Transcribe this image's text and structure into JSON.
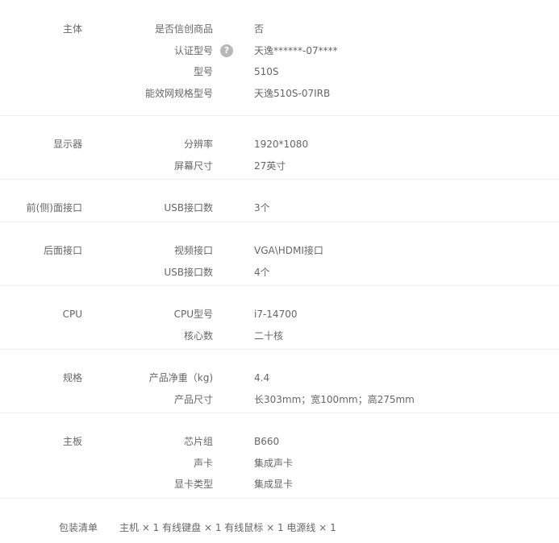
{
  "groups": [
    {
      "title": "主体",
      "rows": [
        {
          "label": "是否信创商品",
          "value": "否"
        },
        {
          "label": "认证型号",
          "value": "天逸******-07****",
          "help": "?"
        },
        {
          "label": "型号",
          "value": "510S"
        },
        {
          "label": "能效网规格型号",
          "value": "天逸510S-07IRB"
        }
      ]
    },
    {
      "title": "显示器",
      "rows": [
        {
          "label": "分辨率",
          "value": "1920*1080"
        },
        {
          "label": "屏幕尺寸",
          "value": "27英寸"
        }
      ]
    },
    {
      "title": "前(侧)面接口",
      "rows": [
        {
          "label": "USB接口数",
          "value": "3个"
        }
      ]
    },
    {
      "title": "后面接口",
      "rows": [
        {
          "label": "视频接口",
          "value": "VGA\\HDMI接口"
        },
        {
          "label": "USB接口数",
          "value": "4个"
        }
      ]
    },
    {
      "title": "CPU",
      "rows": [
        {
          "label": "CPU型号",
          "value": "i7-14700"
        },
        {
          "label": "核心数",
          "value": "二十核"
        }
      ]
    },
    {
      "title": "规格",
      "rows": [
        {
          "label": "产品净重（kg)",
          "value": "4.4"
        },
        {
          "label": "产品尺寸",
          "value": "长303mm；宽100mm；高275mm"
        }
      ]
    },
    {
      "title": "主板",
      "rows": [
        {
          "label": "芯片组",
          "value": "B660"
        },
        {
          "label": "声卡",
          "value": "集成声卡"
        },
        {
          "label": "显卡类型",
          "value": "集成显卡"
        }
      ]
    }
  ],
  "package": {
    "title": "包装清单",
    "content": "主机 × 1 有线键盘 × 1 有线鼠标 × 1 电源线 × 1"
  }
}
